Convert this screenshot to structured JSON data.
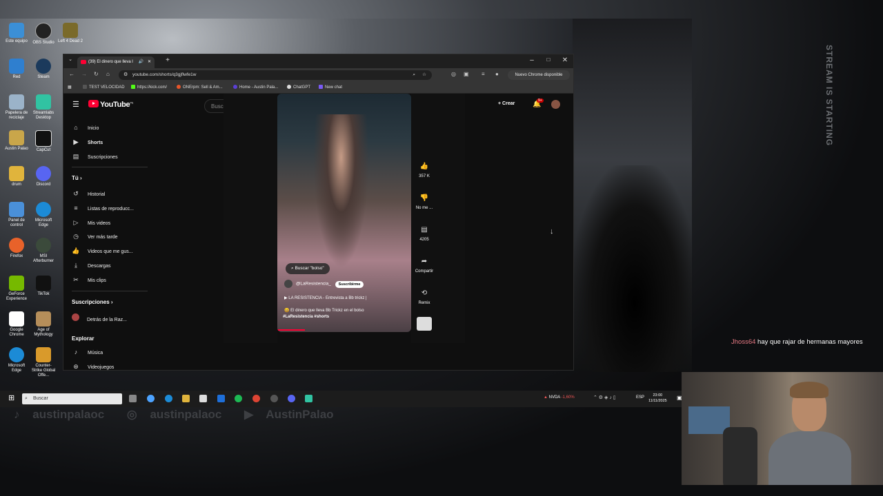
{
  "stream_overlay": {
    "vertical_text": "STREAM IS STARTING"
  },
  "desktop_icons": [
    {
      "label": "Este equipo"
    },
    {
      "label": "OBS Studio"
    },
    {
      "label": "Left 4 Dead 2"
    },
    {
      "label": "Red"
    },
    {
      "label": "Steam"
    },
    {
      "label": "Papelera de reciclaje"
    },
    {
      "label": "Streamlabs Desktop"
    },
    {
      "label": "Austin Palao"
    },
    {
      "label": "CapCut"
    },
    {
      "label": "drum"
    },
    {
      "label": "Discord"
    },
    {
      "label": "Panel de control"
    },
    {
      "label": "Microsoft Edge"
    },
    {
      "label": "Firefox"
    },
    {
      "label": "MSI Afterburner"
    },
    {
      "label": "GeForce Experience"
    },
    {
      "label": "TikTok"
    },
    {
      "label": "Google Chrome"
    },
    {
      "label": "Age of Mythology"
    },
    {
      "label": "Microsoft Edge"
    },
    {
      "label": "Counter-Strike Global Offe..."
    }
  ],
  "browser": {
    "tab_title": "(39) El dinero que lleva l",
    "url": "youtube.com/shorts/q3gjflwfe1w",
    "update_button": "Nuevo Chrome disponible",
    "bookmarks": [
      "TEST VELOCIDAD",
      "https://kick.com/",
      "ONErpm: Sell & Am...",
      "Home - Austin Pala...",
      "ChatGPT",
      "New chat"
    ]
  },
  "youtube": {
    "logo": "YouTube",
    "country_code": "PE",
    "search_placeholder": "Buscar",
    "create_label": "Crear",
    "notif_count": "9+",
    "sidebar": {
      "main": [
        "Inicio",
        "Shorts",
        "Suscripciones"
      ],
      "you_header": "Tú",
      "you_items": [
        "Historial",
        "Listas de reproducc...",
        "Mis videos",
        "Ver más tarde",
        "Videos que me gus...",
        "Descargas",
        "Mis clips"
      ],
      "subs_header": "Suscripciones",
      "subs_items": [
        "Detrás de la Raz..."
      ],
      "explore_header": "Explorar",
      "explore_items": [
        "Música",
        "Videojuegos"
      ]
    },
    "short": {
      "search_chip": "Buscar \"bolso\"",
      "channel": "@LaResistencia_",
      "subscribe": "Suscribirme",
      "related": "LA RESISTENCIA - Entrevista a Bb trickz |",
      "title": "El dinero que lleva Bb Trickz en el bolso",
      "hashtags": "#LaResistencia #shorts"
    },
    "actions": {
      "likes": "357 K",
      "dislike": "No me ...",
      "comments": "4205",
      "share": "Compartir",
      "remix": "Remix"
    }
  },
  "taskbar": {
    "search": "Buscar",
    "stock": "NVDA",
    "stock_change": "-1,60%",
    "lang": "ESP",
    "time": "23:00",
    "date": "11/11/2025"
  },
  "socials": {
    "tiktok": "austinpalaoc",
    "instagram": "austinpalaoc",
    "youtube": "AustinPalao"
  },
  "chat": {
    "user": "Jhoss64",
    "message": "hay que rajar de hermanas mayores"
  }
}
